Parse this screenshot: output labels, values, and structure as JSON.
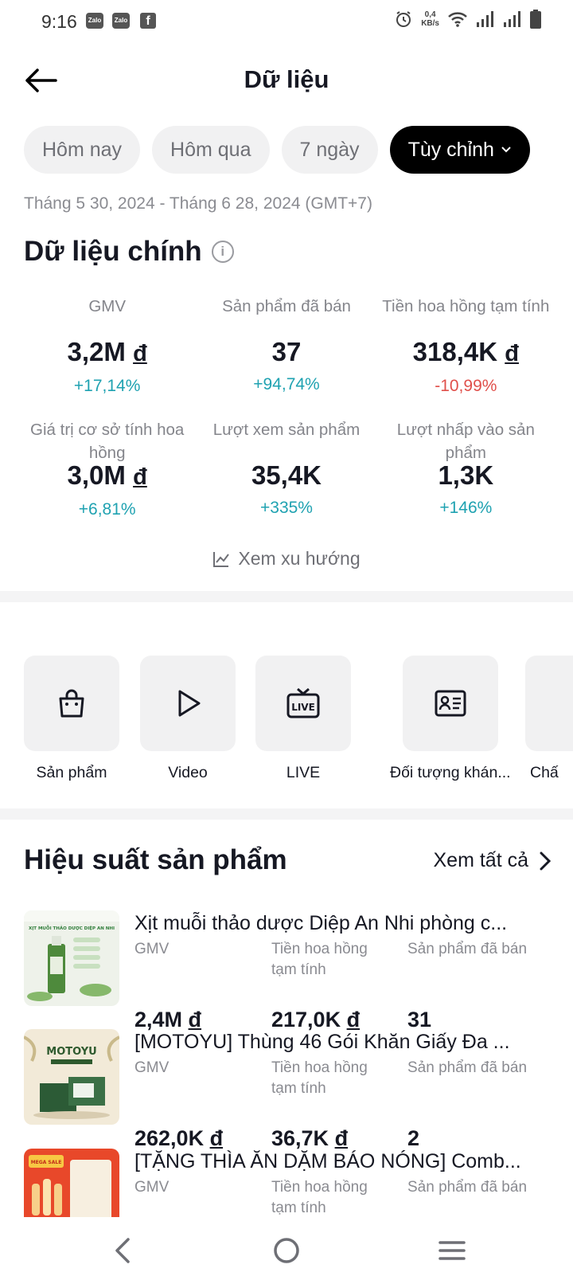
{
  "status_bar": {
    "time": "9:16",
    "apps": [
      "Zalo",
      "Zalo"
    ],
    "facebook": "f",
    "speed_value": "0,4",
    "speed_unit": "KB/s"
  },
  "header": {
    "title": "Dữ liệu"
  },
  "date_chips": [
    {
      "label": "Hôm nay"
    },
    {
      "label": "Hôm qua"
    },
    {
      "label": "7 ngày"
    },
    {
      "label": "Tùy chỉnh"
    }
  ],
  "date_range": "Tháng 5 30, 2024 - Tháng 6 28, 2024 (GMT+7)",
  "main_data": {
    "title": "Dữ liệu chính",
    "info_glyph": "i",
    "metrics": [
      {
        "label": "GMV",
        "value": "3,2M",
        "currency": "đ",
        "change": "+17,14%"
      },
      {
        "label": "Sản phẩm đã bán",
        "value": "37",
        "currency": "",
        "change": "+94,74%"
      },
      {
        "label": "Tiền hoa hồng tạm tính",
        "value": "318,4K",
        "currency": "đ",
        "change": "-10,99%"
      },
      {
        "label": "Giá trị cơ sở tính hoa hồng",
        "value": "3,0M",
        "currency": "đ",
        "change": "+6,81%"
      },
      {
        "label": "Lượt xem sản phẩm",
        "value": "35,4K",
        "currency": "",
        "change": "+335%"
      },
      {
        "label": "Lượt nhấp vào sản phẩm",
        "value": "1,3K",
        "currency": "",
        "change": "+146%"
      }
    ],
    "trend_link": "Xem xu hướng"
  },
  "category_tiles": [
    {
      "label": "Sản phẩm",
      "icon": "shopping-bag-icon"
    },
    {
      "label": "Video",
      "icon": "play-icon"
    },
    {
      "label": "LIVE",
      "icon": "live-tv-icon"
    },
    {
      "label": "Đối tượng khán...",
      "icon": "id-card-icon"
    },
    {
      "label": "Chấ",
      "icon": "unknown-icon"
    }
  ],
  "performance": {
    "title": "Hiệu suất sản phẩm",
    "see_all": "Xem tất cả",
    "col_labels": {
      "gmv": "GMV",
      "commission": "Tiền hoa hồng tạm tính",
      "sold": "Sản phẩm đã bán"
    },
    "products": [
      {
        "name": "Xịt muỗi thảo dược Diệp An Nhi phòng c...",
        "gmv": "2,4M",
        "commission": "217,0K",
        "sold": "31",
        "currency": "đ",
        "thumb_text": "XỊT MUỖI THẢO DƯỢC DIỆP AN NHI"
      },
      {
        "name": "[MOTOYU] Thùng 46 Gói Khăn Giấy Đa ...",
        "gmv": "262,0K",
        "commission": "36,7K",
        "sold": "2",
        "currency": "đ",
        "thumb_text": "MOTOYU"
      },
      {
        "name": "[TẶNG THÌA ĂN DẶM BÁO NÓNG] Comb...",
        "gmv": "",
        "commission": "",
        "sold": "",
        "currency": "",
        "thumb_text": "MEGA SALE"
      }
    ]
  }
}
